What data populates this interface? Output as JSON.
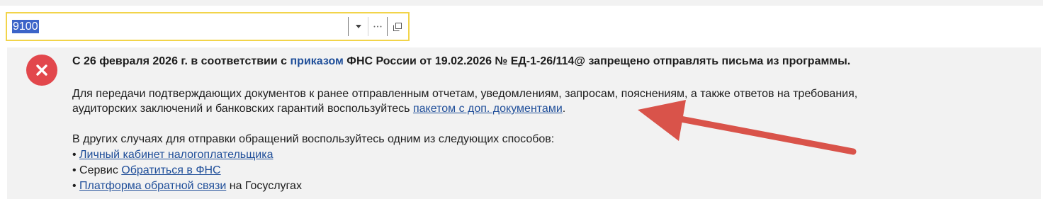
{
  "field": {
    "value": "9100",
    "dropdown_icon": "triangle-down-icon",
    "select_icon": "ellipsis-icon",
    "open_icon": "open-window-icon",
    "border_color": "#f2d44a",
    "selection_color": "#3c64c8"
  },
  "message": {
    "icon": "error-x-icon",
    "icon_color": "#e2474c",
    "headline": {
      "before": "С 26 февраля 2026 г. в соответствии с ",
      "link": "приказом",
      "after": " ФНС России от 19.02.2026 № ЕД-1-26/114@ запрещено отправлять письма из программы."
    },
    "para1": {
      "line1": "Для передачи подтверждающих документов к ранее отправленным отчетам, уведомлениям, запросам, пояснениям, а также ответов на требования,",
      "line2_before": "аудиторских заключений и банковских гарантий воспользуйтесь ",
      "line2_link": "пакетом с доп. документами",
      "line2_after": "."
    },
    "para2": {
      "intro": "В других случаях для отправки обращений воспользуйтесь одним из следующих способов:",
      "items": [
        {
          "bullet": "• ",
          "prefix": "",
          "link": "Личный кабинет налогоплательщика",
          "suffix": ""
        },
        {
          "bullet": "• ",
          "prefix": "Сервис ",
          "link": "Обратиться в ФНС",
          "suffix": ""
        },
        {
          "bullet": "• ",
          "prefix": "",
          "link": "Платформа обратной связи",
          "suffix": " на Госуслугах"
        }
      ]
    },
    "link_color": "#1f4e99"
  },
  "annotation": {
    "arrow_color": "#d9534a"
  }
}
